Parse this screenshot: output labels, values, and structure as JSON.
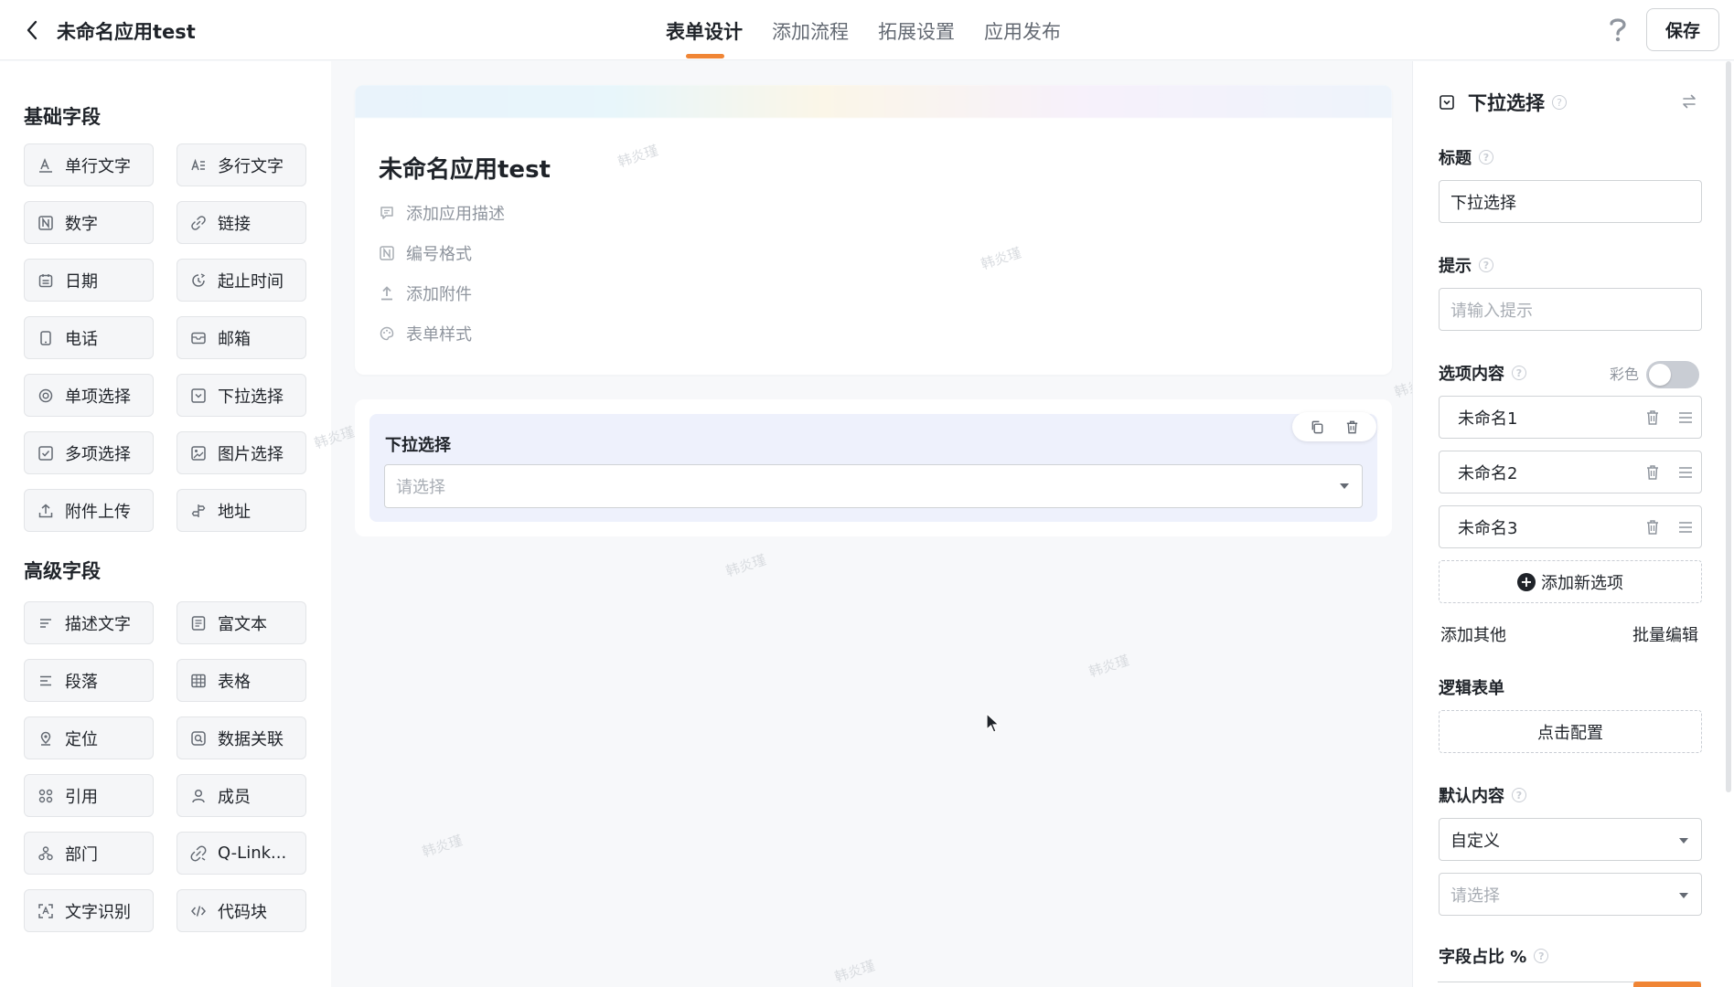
{
  "app": {
    "title": "未命名应用test",
    "save_label": "保存"
  },
  "tabs": [
    {
      "label": "表单设计",
      "active": true
    },
    {
      "label": "添加流程",
      "active": false
    },
    {
      "label": "拓展设置",
      "active": false
    },
    {
      "label": "应用发布",
      "active": false
    }
  ],
  "left": {
    "basic_title": "基础字段",
    "basic_fields": [
      {
        "label": "单行文字",
        "icon": "text-icon"
      },
      {
        "label": "多行文字",
        "icon": "multiline-text-icon"
      },
      {
        "label": "数字",
        "icon": "number-icon"
      },
      {
        "label": "链接",
        "icon": "link-icon"
      },
      {
        "label": "日期",
        "icon": "calendar-icon"
      },
      {
        "label": "起止时间",
        "icon": "time-range-icon"
      },
      {
        "label": "电话",
        "icon": "phone-icon"
      },
      {
        "label": "邮箱",
        "icon": "mail-icon"
      },
      {
        "label": "单项选择",
        "icon": "radio-icon"
      },
      {
        "label": "下拉选择",
        "icon": "dropdown-icon"
      },
      {
        "label": "多项选择",
        "icon": "checkbox-icon"
      },
      {
        "label": "图片选择",
        "icon": "image-icon"
      },
      {
        "label": "附件上传",
        "icon": "upload-icon"
      },
      {
        "label": "地址",
        "icon": "address-icon"
      }
    ],
    "advanced_title": "高级字段",
    "advanced_fields": [
      {
        "label": "描述文字",
        "icon": "description-icon"
      },
      {
        "label": "富文本",
        "icon": "rich-text-icon"
      },
      {
        "label": "段落",
        "icon": "paragraph-icon"
      },
      {
        "label": "表格",
        "icon": "table-icon"
      },
      {
        "label": "定位",
        "icon": "location-icon"
      },
      {
        "label": "数据关联",
        "icon": "data-link-icon"
      },
      {
        "label": "引用",
        "icon": "reference-icon"
      },
      {
        "label": "成员",
        "icon": "member-icon"
      },
      {
        "label": "部门",
        "icon": "department-icon"
      },
      {
        "label": "Q-Link...",
        "icon": "qlink-icon"
      },
      {
        "label": "文字识别",
        "icon": "ocr-icon"
      },
      {
        "label": "代码块",
        "icon": "code-icon"
      }
    ]
  },
  "form": {
    "title": "未命名应用test",
    "meta": [
      {
        "label": "添加应用描述",
        "icon": "comment-icon"
      },
      {
        "label": "编号格式",
        "icon": "number-format-icon"
      },
      {
        "label": "添加附件",
        "icon": "attachment-icon"
      },
      {
        "label": "表单样式",
        "icon": "palette-icon"
      }
    ],
    "field": {
      "label": "下拉选择",
      "placeholder": "请选择"
    },
    "watermark": "韩炎瑾"
  },
  "props": {
    "panel_title": "下拉选择",
    "title_label": "标题",
    "title_value": "下拉选择",
    "hint_label": "提示",
    "hint_placeholder": "请输入提示",
    "options_label": "选项内容",
    "color_label": "彩色",
    "color_enabled": false,
    "options": [
      "未命名1",
      "未命名2",
      "未命名3"
    ],
    "add_option_label": "添加新选项",
    "add_other_label": "添加其他",
    "batch_edit_label": "批量编辑",
    "logic_label": "逻辑表单",
    "logic_button": "点击配置",
    "default_label": "默认内容",
    "default_mode": "自定义",
    "default_placeholder": "请选择",
    "ratio_label": "字段占比 %"
  },
  "colors": {
    "accent": "#f08535",
    "field_selected_bg": "#eef1fc"
  }
}
